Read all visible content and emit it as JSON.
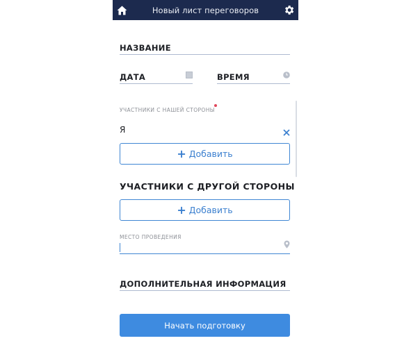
{
  "header": {
    "title": "Новый лист переговоров",
    "home_icon": "home-icon",
    "settings_icon": "gear-icon",
    "background": "#1c2a4e"
  },
  "form": {
    "name_label": "НАЗВАНИЕ",
    "date_label": "ДАТА",
    "time_label": "ВРЕМЯ",
    "our_side_label": "УЧАСТНИКИ С НАШЕЙ СТОРОНЫ",
    "our_participants": [
      {
        "name": "Я"
      }
    ],
    "add_label": "Добавить",
    "other_side_title": "УЧАСТНИКИ С ДРУГОЙ СТОРОНЫ",
    "venue_label": "МЕСТО ПРОВЕДЕНИЯ",
    "venue_value": "",
    "additional_info_label": "ДОПОЛНИТЕЛЬНАЯ ИНФОРМАЦИЯ"
  },
  "actions": {
    "start_label": "Начать подготовку"
  },
  "colors": {
    "accent": "#3e8be0",
    "required": "#e0465a"
  }
}
